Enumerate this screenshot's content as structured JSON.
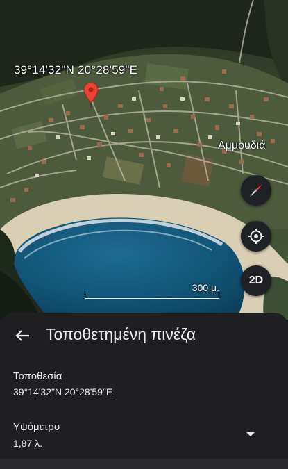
{
  "map": {
    "coordinates_label": "39°14'32\"N 20°28'59\"E",
    "place_label": "Αμμουδιά",
    "scale_label": "300 μ.",
    "compass_icon": "compass-icon",
    "locate_icon": "my-location-icon",
    "view_toggle_label": "2D",
    "pin_color": "#ea4335"
  },
  "sheet": {
    "back_icon": "arrow-left-icon",
    "title": "Τοποθετημένη πινέζα",
    "location_label": "Τοποθεσία",
    "location_value": "39°14'32\"N 20°28'59\"E",
    "elevation_label": "Υψόμετρο",
    "elevation_value": "1,87 λ.",
    "expand_icon": "chevron-down-icon"
  }
}
